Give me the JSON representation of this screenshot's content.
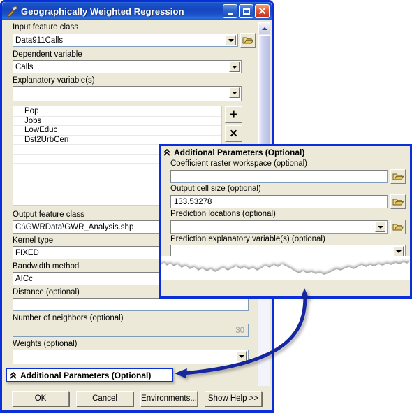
{
  "window": {
    "title": "Geographically Weighted Regression",
    "icon": "hammer-tool-icon",
    "buttons": {
      "minimize": "minimize-icon",
      "maximize": "maximize-icon",
      "close": "close-icon"
    }
  },
  "form": {
    "fields": [
      {
        "label": "Input feature class",
        "value": "Data911Calls",
        "type": "combo-with-browse"
      },
      {
        "label": "Dependent variable",
        "value": "Calls",
        "type": "combo"
      },
      {
        "label": "Explanatory variable(s)",
        "value": "",
        "type": "combo"
      }
    ],
    "explanatory_list": [
      "Pop",
      "Jobs",
      "LowEduc",
      "Dst2UrbCen"
    ],
    "list_buttons": {
      "add": "+",
      "remove": "×"
    },
    "fields2": [
      {
        "label": "Output feature class",
        "value": "C:\\GWRData\\GWR_Analysis.shp",
        "type": "text"
      },
      {
        "label": "Kernel type",
        "value": "FIXED",
        "type": "text"
      },
      {
        "label": "Bandwidth method",
        "value": "AICc",
        "type": "text"
      },
      {
        "label": "Distance (optional)",
        "value": "",
        "type": "text"
      },
      {
        "label": "Number of neighbors (optional)",
        "value": "30",
        "type": "text-disabled"
      },
      {
        "label": "Weights (optional)",
        "value": "",
        "type": "combo"
      }
    ]
  },
  "additional_bar": {
    "chevron": "double-chevron-up-icon",
    "label": "Additional Parameters (Optional)"
  },
  "dialog_buttons": [
    {
      "label": "OK",
      "name": "ok-button"
    },
    {
      "label": "Cancel",
      "name": "cancel-button"
    },
    {
      "label": "Environments...",
      "name": "environments-button"
    },
    {
      "label": "Show Help >>",
      "name": "show-help-button"
    }
  ],
  "popup": {
    "chevron": "double-chevron-up-icon",
    "title": "Additional Parameters (Optional)",
    "fields": [
      {
        "label": "Coefficient raster workspace (optional)",
        "value": "",
        "type": "text-with-browse"
      },
      {
        "label": "Output cell size (optional)",
        "value": "133.53278",
        "type": "text-with-browse"
      },
      {
        "label": "Prediction locations (optional)",
        "value": "",
        "type": "combo-with-browse"
      },
      {
        "label": "Prediction explanatory variable(s) (optional)",
        "value": "",
        "type": "combo"
      }
    ],
    "add_button": "+"
  },
  "scrollbar": {
    "up_arrow": "scroll-up-icon",
    "thumb": "scroll-thumb"
  },
  "colors": {
    "highlight": "#0a2fd8",
    "title_blue": "#1446c0",
    "dialog_face": "#ece9d8",
    "field_white": "#ffffff",
    "disabled_text": "#a0a0a0"
  }
}
